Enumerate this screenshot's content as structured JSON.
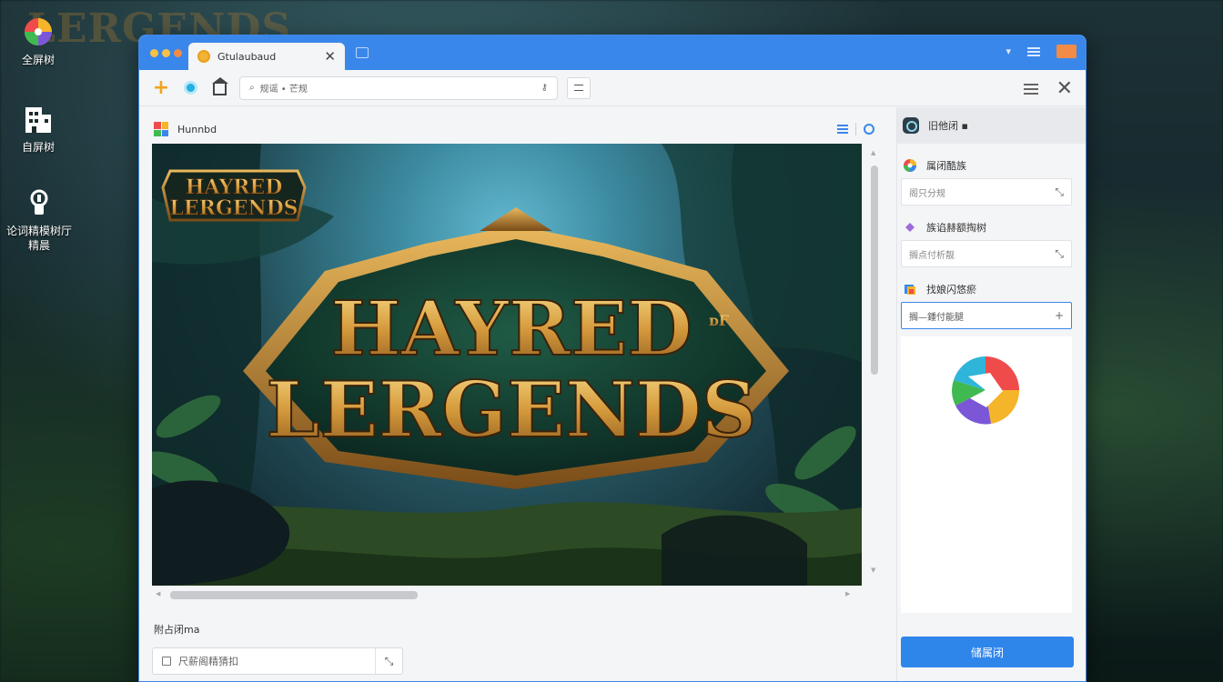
{
  "desktop": {
    "icons": [
      {
        "label": "全屏树"
      },
      {
        "label": "自屏树"
      },
      {
        "label": "论词精模树厅",
        "label2": "精晨"
      }
    ]
  },
  "window": {
    "tab_title": "Gtulaubaud",
    "colors": {
      "titlebar": "#3a87eb",
      "accent": "#2f86ea",
      "maximize": "#f28b45"
    }
  },
  "toolbar": {
    "address_text": "规谣 • 芒规"
  },
  "main": {
    "pane_title": "Hunnbd",
    "game_title_line1": "HAYRED",
    "game_title_line2": "LERGENDS",
    "game_title_suffix": "ᴅF",
    "corner_logo_line1": "HAYRED",
    "corner_logo_line2": "LERGENDS",
    "bottom_label": "附占闭ma",
    "bottom_input_value": "尺薪阁精猜扣"
  },
  "right_panel": {
    "header_title": "旧他闭 ▪",
    "sections": [
      {
        "title": "属闭酷族",
        "input_value": "阁只分规",
        "action": "⤡"
      },
      {
        "title": "族谄赫额掏树",
        "input_value": "搁点付析靓",
        "action": "⤡"
      },
      {
        "title": "找娘闪悠瘀",
        "input_value": "搁—鍾付能腿",
        "action": "+"
      }
    ],
    "button_label": "储属闭"
  }
}
